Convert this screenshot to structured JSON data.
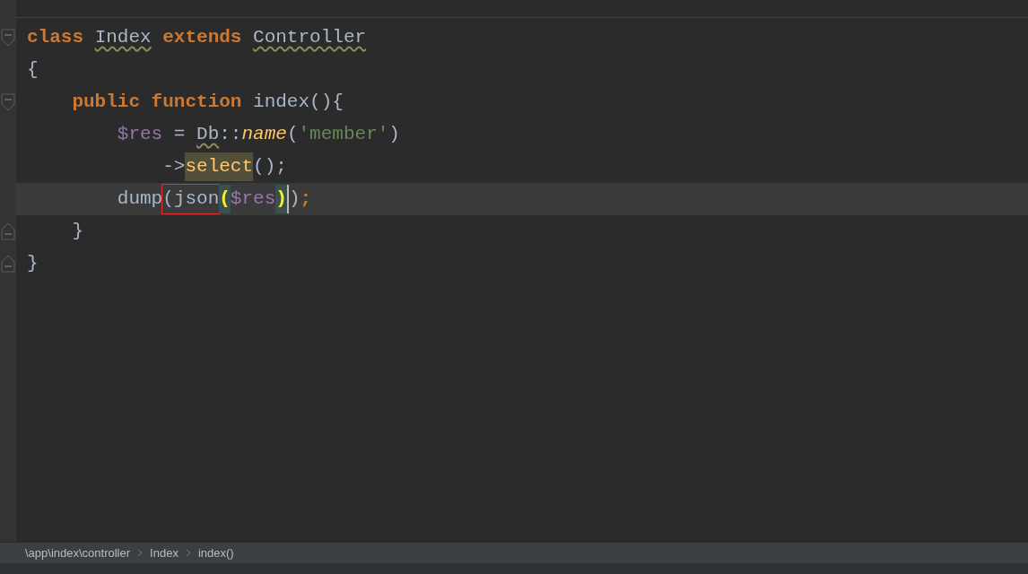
{
  "editor": {
    "lines": [
      {
        "kind": "fold_start",
        "current": false,
        "tokens": [
          {
            "text": "class ",
            "kind": "keyword"
          },
          {
            "text": "Index",
            "kind": "class_ref"
          },
          {
            "text": " extends ",
            "kind": "keyword"
          },
          {
            "text": "Controller",
            "kind": "class_ref"
          }
        ]
      },
      {
        "kind": "plain",
        "current": false,
        "tokens": [
          {
            "text": "{",
            "kind": "plain"
          }
        ]
      },
      {
        "kind": "fold_start",
        "current": false,
        "tokens": [
          {
            "text": "    public function",
            "kind": "keyword"
          },
          {
            "text": " index(){",
            "kind": "plain"
          }
        ]
      },
      {
        "kind": "plain",
        "current": false,
        "tokens": [
          {
            "text": "        $res",
            "kind": "variable"
          },
          {
            "text": " = ",
            "kind": "plain"
          },
          {
            "text": "Db",
            "kind": "class_ref"
          },
          {
            "text": "::",
            "kind": "plain"
          },
          {
            "text": "name",
            "kind": "method"
          },
          {
            "text": "(",
            "kind": "plain"
          },
          {
            "text": "'member'",
            "kind": "string"
          },
          {
            "text": ")",
            "kind": "plain"
          }
        ]
      },
      {
        "kind": "plain",
        "current": false,
        "tokens": [
          {
            "text": "            ->",
            "kind": "plain"
          },
          {
            "text": "select",
            "kind": "highlight"
          },
          {
            "text": "();",
            "kind": "plain"
          }
        ]
      },
      {
        "kind": "plain",
        "current": true,
        "tokens": [
          {
            "text": "        dump",
            "kind": "plain"
          },
          {
            "text": "(json",
            "kind": "boxed"
          },
          {
            "text": "(",
            "kind": "paren_match"
          },
          {
            "text": "$res",
            "kind": "variable"
          },
          {
            "text": ")",
            "kind": "paren_match"
          },
          {
            "text": ")",
            "kind": "caret"
          },
          {
            "text": ";",
            "kind": "keyword"
          }
        ]
      },
      {
        "kind": "fold_end",
        "current": false,
        "tokens": [
          {
            "text": "    }",
            "kind": "plain"
          }
        ]
      },
      {
        "kind": "fold_end",
        "current": false,
        "tokens": [
          {
            "text": "}",
            "kind": "plain"
          }
        ]
      }
    ]
  },
  "breadcrumbs": [
    "\\app\\index\\controller",
    "Index",
    "index()"
  ]
}
